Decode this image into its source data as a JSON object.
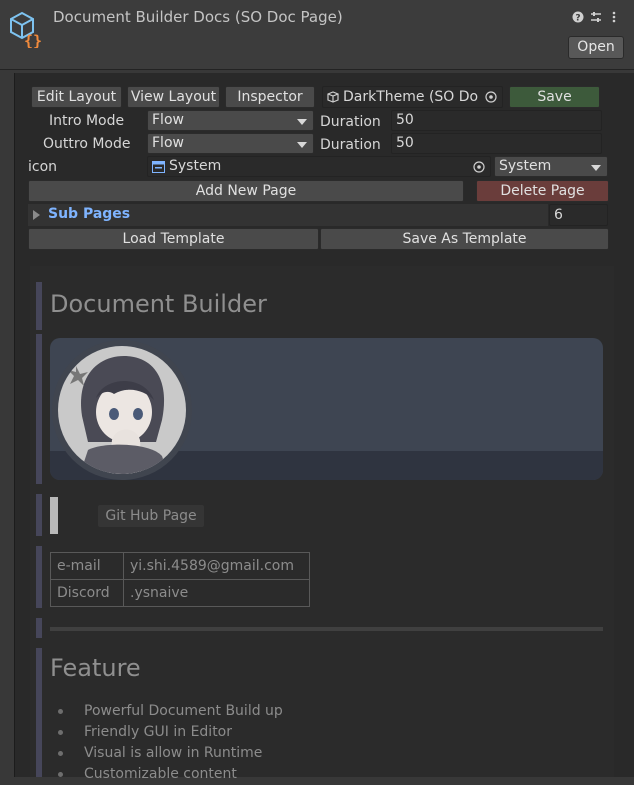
{
  "window": {
    "title": "Document Builder Docs (SO Doc Page)",
    "open_label": "Open",
    "icons": [
      "help-icon",
      "settings-sliders-icon",
      "more-vert-icon"
    ]
  },
  "toolbar": {
    "edit_layout": "Edit Layout",
    "view_layout": "View Layout",
    "inspector": "Inspector",
    "theme_field": "DarkTheme (SO Do",
    "save": "Save"
  },
  "settings": {
    "intro_label": "Intro Mode",
    "intro_value": "Flow",
    "intro_duration_label": "Duration",
    "intro_duration": "50",
    "outtro_label": "Outtro Mode",
    "outtro_value": "Flow",
    "outtro_duration_label": "Duration",
    "outtro_duration": "50",
    "icon_label": "icon",
    "icon_value": "System",
    "icon_dropdown": "System"
  },
  "pages": {
    "add_new_page": "Add New Page",
    "delete_page": "Delete Page",
    "sub_pages_label": "Sub Pages",
    "sub_pages_count": "6",
    "load_template": "Load Template",
    "save_as_template": "Save As Template"
  },
  "document": {
    "title": "Document Builder",
    "github_button": "Git Hub Page",
    "contacts": [
      {
        "key": "e-mail",
        "value": "yi.shi.4589@gmail.com"
      },
      {
        "key": "Discord",
        "value": ".ysnaive"
      }
    ],
    "feature_title": "Feature",
    "features": [
      "Powerful Document Build up",
      "Friendly GUI in Editor",
      "Visual is allow in Runtime",
      "Customizable content"
    ]
  },
  "colors": {
    "save_button": "#3d5a3b",
    "delete_button": "#6a3d3b",
    "accent_bar": "#46465a",
    "sub_pages_text": "#7fb4ff"
  }
}
